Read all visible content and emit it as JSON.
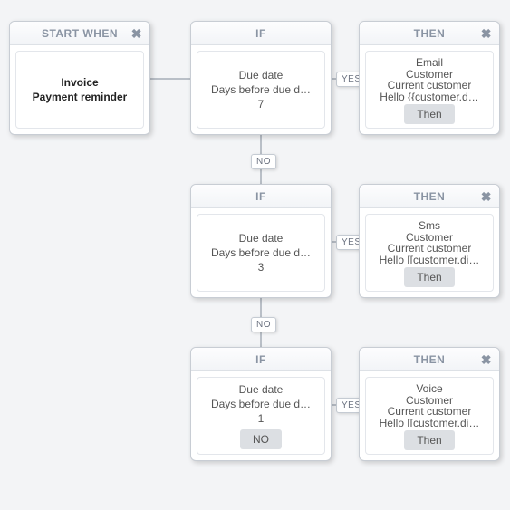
{
  "labels": {
    "yes": "YES",
    "no": "NO"
  },
  "start": {
    "title": "START WHEN",
    "line1": "Invoice",
    "line2": "Payment reminder"
  },
  "if1": {
    "title": "IF",
    "line1": "Due date",
    "line2": "Days before due d…",
    "value": "7"
  },
  "then1": {
    "title": "THEN",
    "line1": "Email",
    "line2": "Customer",
    "line3": "Current customer",
    "line4": "Hello {{customer.d…",
    "button": "Then"
  },
  "if2": {
    "title": "IF",
    "line1": "Due date",
    "line2": "Days before due d…",
    "value": "3"
  },
  "then2": {
    "title": "THEN",
    "line1": "Sms",
    "line2": "Customer",
    "line3": "Current customer",
    "line4": "Hello [[customer.di…",
    "button": "Then"
  },
  "if3": {
    "title": "IF",
    "line1": "Due date",
    "line2": "Days before due d…",
    "value": "1",
    "button": "NO"
  },
  "then3": {
    "title": "THEN",
    "line1": "Voice",
    "line2": "Customer",
    "line3": "Current customer",
    "line4": "Hello [[customer.di…",
    "button": "Then"
  }
}
